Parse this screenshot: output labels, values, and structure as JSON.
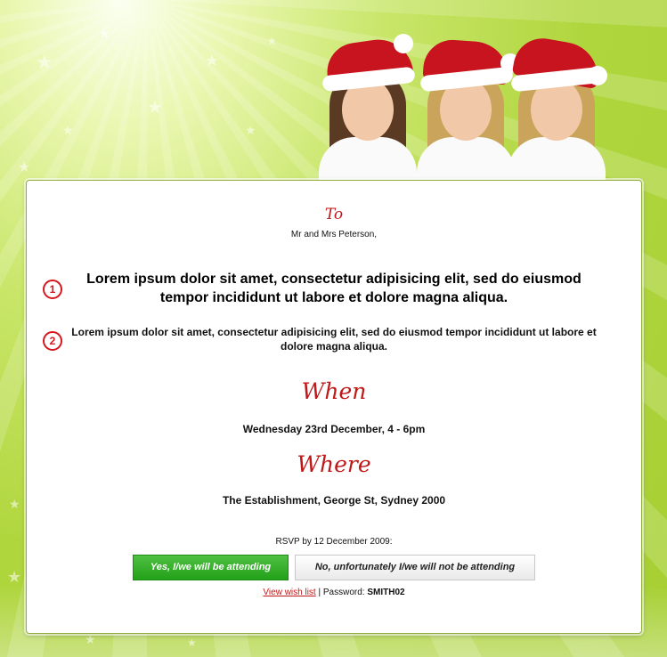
{
  "invite": {
    "to_label": "To",
    "to_name": "Mr and Mrs Peterson,",
    "item1_number": "1",
    "item1_text": "Lorem ipsum dolor sit amet, consectetur adipisicing elit, sed do eiusmod tempor incididunt ut labore et dolore magna aliqua.",
    "item2_number": "2",
    "item2_text": "Lorem ipsum dolor sit amet, consectetur adipisicing elit, sed do eiusmod tempor incididunt ut labore et dolore magna aliqua.",
    "when_heading": "When",
    "when_text": "Wednesday 23rd December, 4 - 6pm",
    "where_heading": "Where",
    "where_text": "The Establishment, George St, Sydney 2000"
  },
  "rsvp": {
    "label": "RSVP by 12 December 2009:",
    "yes_button": "Yes, I/we will be attending",
    "no_button": "No, unfortunately I/we will not be attending",
    "wish_link": "View wish list",
    "separator": "|",
    "password_label": "Password:",
    "password_value": "SMITH02"
  },
  "colors": {
    "accent_red": "#c01818",
    "yes_green": "#23a11a",
    "background_green": "#b0d63e"
  },
  "icons": {
    "decoration": "star-icon",
    "item_marker": "circled-number-icon"
  }
}
